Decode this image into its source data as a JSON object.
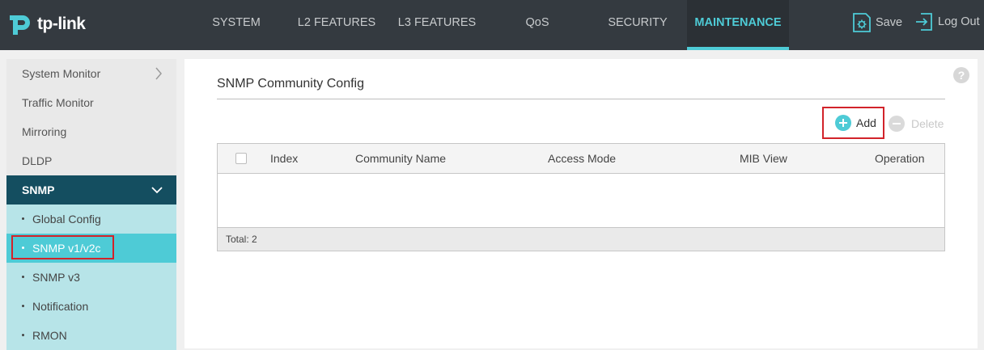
{
  "brand": {
    "name": "tp-link",
    "color": "#4ecbd6"
  },
  "nav": {
    "items": [
      "SYSTEM",
      "L2 FEATURES",
      "L3 FEATURES",
      "QoS",
      "SECURITY",
      "MAINTENANCE"
    ],
    "active": "MAINTENANCE",
    "save_label": "Save",
    "logout_label": "Log Out"
  },
  "sidebar": {
    "items": [
      {
        "label": "System Monitor",
        "icon": "chevron-right-icon"
      },
      {
        "label": "Traffic Monitor"
      },
      {
        "label": "Mirroring"
      },
      {
        "label": "DLDP"
      },
      {
        "label": "SNMP",
        "icon": "chevron-down-icon",
        "expanded": true
      },
      {
        "label": "Global Config"
      },
      {
        "label": "SNMP v1/v2c",
        "active": true
      },
      {
        "label": "SNMP v3"
      },
      {
        "label": "Notification"
      },
      {
        "label": "RMON"
      }
    ]
  },
  "main": {
    "help_label": "?",
    "section_title": "SNMP Community Config",
    "add_label": "Add",
    "delete_label": "Delete",
    "table": {
      "columns": [
        "Index",
        "Community Name",
        "Access Mode",
        "MIB View",
        "Operation"
      ],
      "rows": [],
      "footer": "Total: 2"
    }
  },
  "colors": {
    "accent": "#4ecbd6",
    "topbar": "#343a40",
    "sidebar_group": "#144e60",
    "highlight": "#d2232a"
  }
}
